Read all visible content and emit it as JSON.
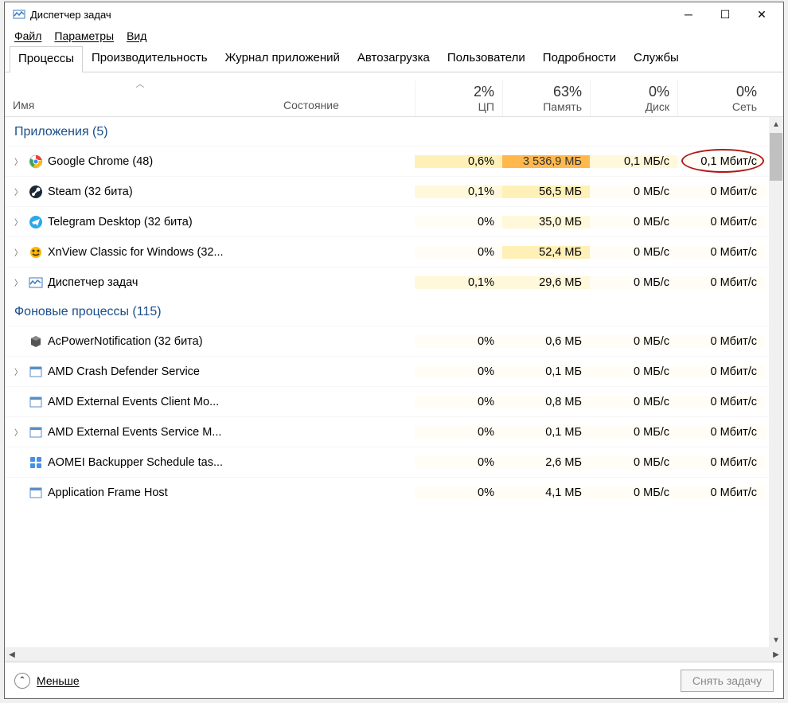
{
  "title": "Диспетчер задач",
  "menu": [
    "Файл",
    "Параметры",
    "Вид"
  ],
  "tabs": [
    "Процессы",
    "Производительность",
    "Журнал приложений",
    "Автозагрузка",
    "Пользователи",
    "Подробности",
    "Службы"
  ],
  "active_tab": 0,
  "headers": {
    "name": "Имя",
    "status": "Состояние",
    "cols": [
      {
        "pct": "2%",
        "label": "ЦП"
      },
      {
        "pct": "63%",
        "label": "Память"
      },
      {
        "pct": "0%",
        "label": "Диск"
      },
      {
        "pct": "0%",
        "label": "Сеть"
      }
    ]
  },
  "groups": [
    {
      "title": "Приложения (5)",
      "rows": [
        {
          "exp": true,
          "icon": "chrome",
          "name": "Google Chrome (48)",
          "cpu": "0,6%",
          "mem": "3 536,9 МБ",
          "disk": "0,1 МБ/с",
          "net": "0,1 Мбит/с",
          "h": [
            2,
            4,
            1,
            0
          ],
          "annot": true
        },
        {
          "exp": true,
          "icon": "steam",
          "name": "Steam (32 бита)",
          "cpu": "0,1%",
          "mem": "56,5 МБ",
          "disk": "0 МБ/с",
          "net": "0 Мбит/с",
          "h": [
            1,
            2,
            0,
            0
          ]
        },
        {
          "exp": true,
          "icon": "telegram",
          "name": "Telegram Desktop (32 бита)",
          "cpu": "0%",
          "mem": "35,0 МБ",
          "disk": "0 МБ/с",
          "net": "0 Мбит/с",
          "h": [
            0,
            1,
            0,
            0
          ]
        },
        {
          "exp": true,
          "icon": "xnview",
          "name": "XnView Classic for Windows (32...",
          "cpu": "0%",
          "mem": "52,4 МБ",
          "disk": "0 МБ/с",
          "net": "0 Мбит/с",
          "h": [
            0,
            2,
            0,
            0
          ]
        },
        {
          "exp": true,
          "icon": "tm",
          "name": "Диспетчер задач",
          "cpu": "0,1%",
          "mem": "29,6 МБ",
          "disk": "0 МБ/с",
          "net": "0 Мбит/с",
          "h": [
            1,
            1,
            0,
            0
          ]
        }
      ]
    },
    {
      "title": "Фоновые процессы (115)",
      "rows": [
        {
          "exp": false,
          "icon": "cube",
          "name": "AcPowerNotification (32 бита)",
          "cpu": "0%",
          "mem": "0,6 МБ",
          "disk": "0 МБ/с",
          "net": "0 Мбит/с",
          "h": [
            0,
            0,
            0,
            0
          ]
        },
        {
          "exp": true,
          "icon": "generic",
          "name": "AMD Crash Defender Service",
          "cpu": "0%",
          "mem": "0,1 МБ",
          "disk": "0 МБ/с",
          "net": "0 Мбит/с",
          "h": [
            0,
            0,
            0,
            0
          ]
        },
        {
          "exp": false,
          "icon": "generic",
          "name": "AMD External Events Client Mo...",
          "cpu": "0%",
          "mem": "0,8 МБ",
          "disk": "0 МБ/с",
          "net": "0 Мбит/с",
          "h": [
            0,
            0,
            0,
            0
          ]
        },
        {
          "exp": true,
          "icon": "generic",
          "name": "AMD External Events Service M...",
          "cpu": "0%",
          "mem": "0,1 МБ",
          "disk": "0 МБ/с",
          "net": "0 Мбит/с",
          "h": [
            0,
            0,
            0,
            0
          ]
        },
        {
          "exp": false,
          "icon": "aomei",
          "name": "AOMEI Backupper Schedule tas...",
          "cpu": "0%",
          "mem": "2,6 МБ",
          "disk": "0 МБ/с",
          "net": "0 Мбит/с",
          "h": [
            0,
            0,
            0,
            0
          ]
        },
        {
          "exp": false,
          "icon": "generic",
          "name": "Application Frame Host",
          "cpu": "0%",
          "mem": "4,1 МБ",
          "disk": "0 МБ/с",
          "net": "0 Мбит/с",
          "h": [
            0,
            0,
            0,
            0
          ]
        }
      ]
    }
  ],
  "footer": {
    "fewer": "Меньше",
    "end": "Снять задачу"
  }
}
